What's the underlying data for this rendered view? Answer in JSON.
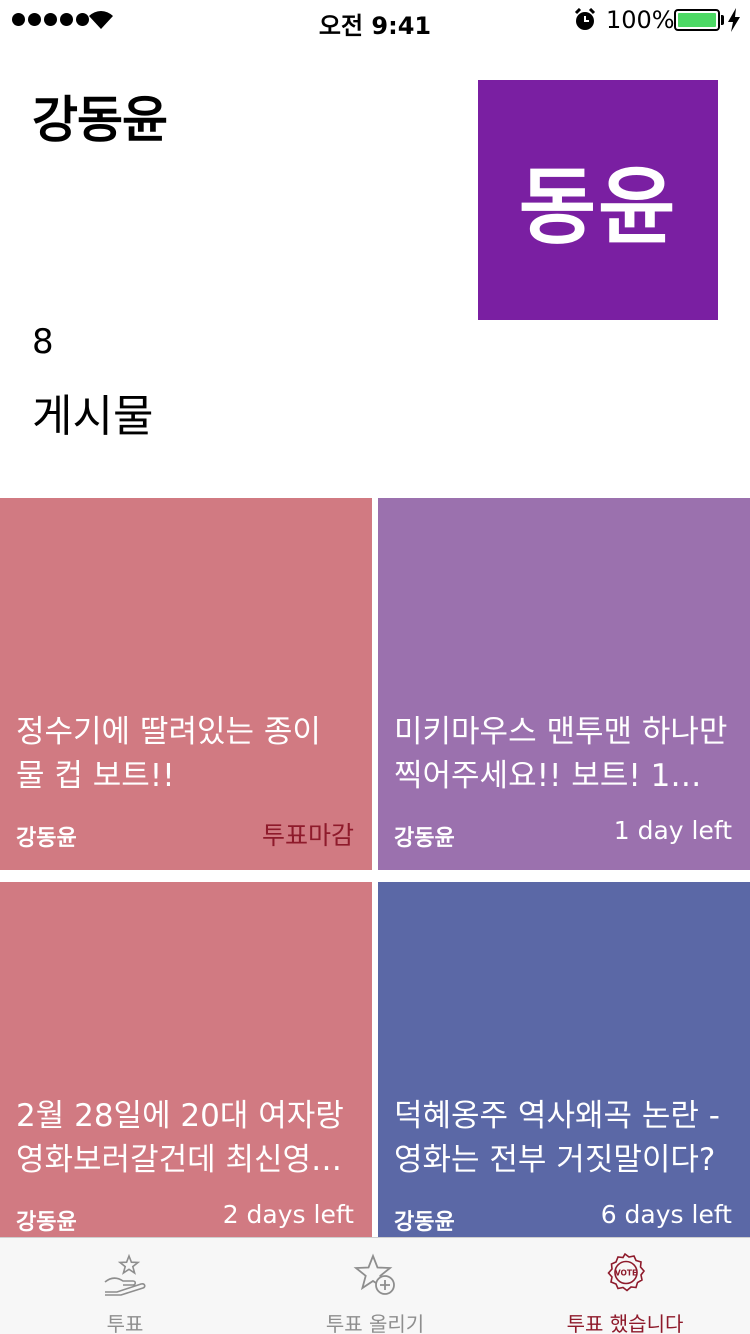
{
  "status_bar": {
    "time": "오전 9:41",
    "battery_percent": "100%",
    "battery_level": 1.0,
    "signal_bars": 5,
    "icons": [
      "signal-icon",
      "wifi-icon",
      "alarm-icon",
      "battery-icon",
      "charging-icon"
    ]
  },
  "profile": {
    "name": "강동윤",
    "avatar_text": "동윤",
    "avatar_color": "#7a1fa2",
    "post_count": "8",
    "post_label": "게시물"
  },
  "posts": [
    {
      "title": "정수기에 딸려있는 종이 물 컵 보트!!",
      "author": "강동윤",
      "remaining": "투표마감",
      "color": "#d17a82"
    },
    {
      "title": "미키마우스 맨투맨 하나만 찍어주세요!! 보트! 1…",
      "author": "강동윤",
      "remaining": "1 day left",
      "color": "#9b71ae"
    },
    {
      "title": "2월 28일에 20대 여자랑 영화보러갈건데 최신영…",
      "author": "강동윤",
      "remaining": "2 days left",
      "color": "#d17a82"
    },
    {
      "title": "덕혜옹주 역사왜곡 논란 - 영화는 전부 거짓말이다?",
      "author": "강동윤",
      "remaining": "6 days left",
      "color": "#5b68a6"
    }
  ],
  "tab_bar": {
    "active_color": "#8e1a2b",
    "tabs": [
      {
        "label": "투표",
        "icon": "vote-hand-star-icon"
      },
      {
        "label": "투표 올리기",
        "icon": "add-vote-star-icon"
      },
      {
        "label": "투표 했습니다",
        "icon": "vote-badge-icon"
      }
    ]
  }
}
